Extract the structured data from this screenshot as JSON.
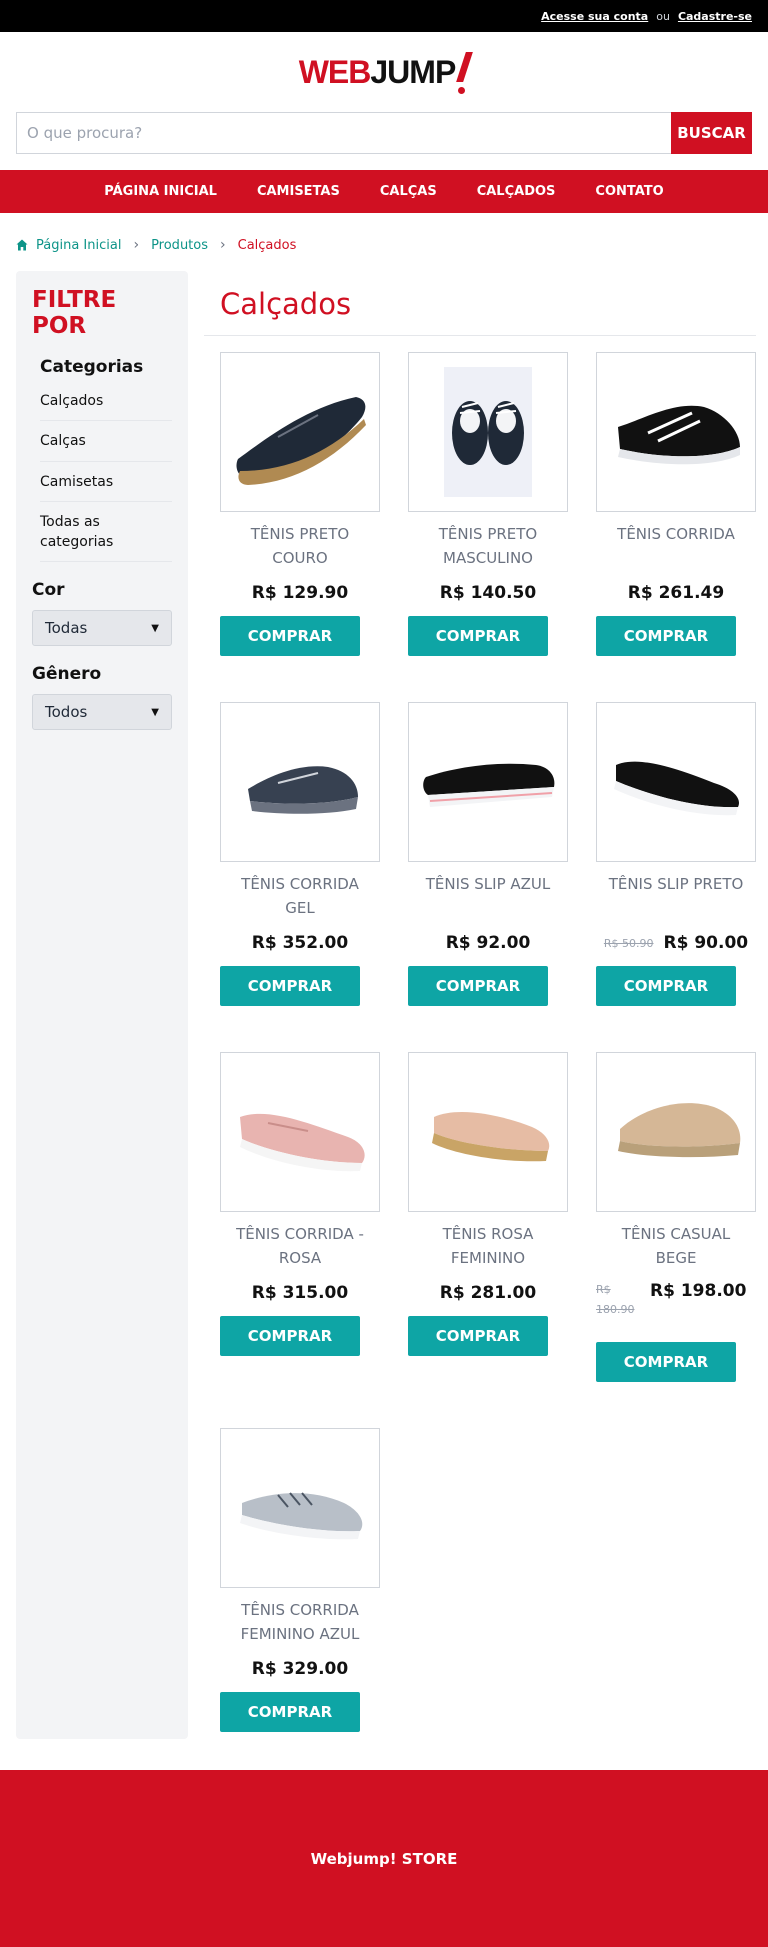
{
  "topbar": {
    "login_link": "Acesse sua conta",
    "separator": "ou",
    "register_link": "Cadastre-se"
  },
  "logo": {
    "text_red": "WEB",
    "text_dark": "JUMP"
  },
  "search": {
    "placeholder": "O que procura?",
    "button_label": "BUSCAR"
  },
  "nav": {
    "items": [
      "PÁGINA INICIAL",
      "CAMISETAS",
      "CALÇAS",
      "CALÇADOS",
      "CONTATO"
    ]
  },
  "breadcrumb": {
    "home": "Página Inicial",
    "products": "Produtos",
    "current": "Calçados"
  },
  "sidebar": {
    "title": "FILTRE POR",
    "categories_title": "Categorias",
    "categories": [
      "Calçados",
      "Calças",
      "Camisetas",
      "Todas as categorias"
    ],
    "color_title": "Cor",
    "color_selected": "Todas",
    "gender_title": "Gênero",
    "gender_selected": "Todos"
  },
  "page_title": "Calçados",
  "buy_label": "COMPRAR",
  "products": [
    {
      "name": "TÊNIS PRETO COURO",
      "price": "R$ 129.90",
      "old_price": ""
    },
    {
      "name": "TÊNIS PRETO MASCULINO",
      "price": "R$ 140.50",
      "old_price": ""
    },
    {
      "name": "TÊNIS CORRIDA",
      "price": "R$ 261.49",
      "old_price": ""
    },
    {
      "name": "TÊNIS CORRIDA GEL",
      "price": "R$ 352.00",
      "old_price": ""
    },
    {
      "name": "TÊNIS SLIP AZUL",
      "price": "R$ 92.00",
      "old_price": ""
    },
    {
      "name": "TÊNIS SLIP PRETO",
      "price": "R$ 90.00",
      "old_price": "R$ 50.90"
    },
    {
      "name": "TÊNIS CORRIDA - ROSA",
      "price": "R$ 315.00",
      "old_price": ""
    },
    {
      "name": "TÊNIS ROSA FEMININO",
      "price": "R$ 281.00",
      "old_price": ""
    },
    {
      "name": "TÊNIS CASUAL BEGE",
      "price": "R$ 198.00",
      "old_price": "R$ 180.90"
    },
    {
      "name": "TÊNIS CORRIDA FEMININO AZUL",
      "price": "R$ 329.00",
      "old_price": ""
    }
  ],
  "footer": {
    "text": "Webjump! STORE"
  },
  "colors": {
    "brand_red": "#d01022",
    "teal": "#0ea5a5",
    "link_teal": "#0d9488"
  }
}
